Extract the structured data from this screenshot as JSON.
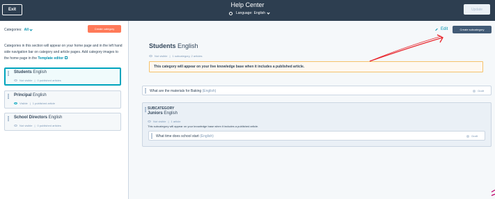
{
  "topbar": {
    "exit_label": "Exit",
    "title": "Help Center",
    "language_label": "Language:",
    "language_value": "English",
    "update_label": "Update"
  },
  "sidebar": {
    "filter_label": "Categories:",
    "filter_value": "All",
    "create_category_label": "Create category",
    "description": "Categories in this section will appear on your home page and in the left hand side navigation bar on category and article pages. Add category images to the home page in the ",
    "template_editor_link": "Template editor",
    "categories": [
      {
        "name": "Students",
        "lang": "English",
        "visibility": "Not visible",
        "articles": "0 published articles"
      },
      {
        "name": "Principal",
        "lang": "English",
        "visibility": "Visible",
        "articles": "1 published article"
      },
      {
        "name": "School Directors",
        "lang": "English",
        "visibility": "Not visible",
        "articles": "0 published articles"
      }
    ]
  },
  "main": {
    "edit_label": "Edit",
    "create_subcategory_label": "Create subcategory",
    "category_title": "Students",
    "category_lang": "English",
    "category_visibility": "Not visible",
    "category_counts": "1 subcategory, 2 articles",
    "notice": "This category will appear on your live knowledge base when it includes a published article.",
    "articles": [
      {
        "title": "What are the materials for Baking",
        "lang": "(English)",
        "status": "Draft"
      }
    ],
    "subcategory": {
      "label": "SUBCATEGORY",
      "name": "Juniors",
      "lang": "English",
      "visibility": "Not visible",
      "count": "1 article",
      "notice": "This subcategory will appear on your knowledge base when it includes a published article.",
      "articles": [
        {
          "title": "What time does school start",
          "lang": "(English)",
          "status": "Draft"
        }
      ]
    }
  },
  "colors": {
    "topbar": "#2d3e50",
    "accent": "#0091ae",
    "primary_button": "#ff7a59",
    "annotation": "#e8232a"
  }
}
